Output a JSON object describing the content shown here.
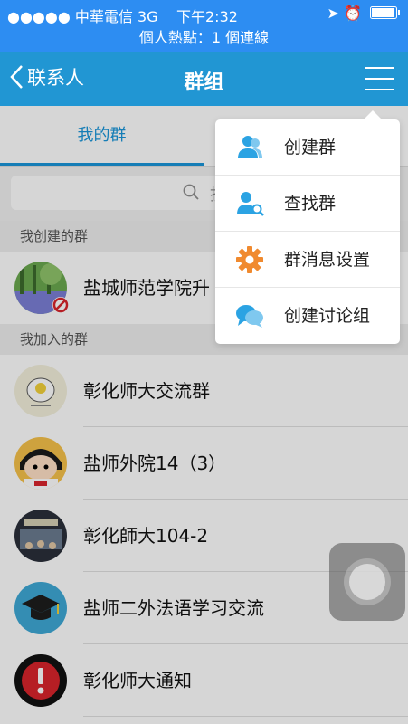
{
  "status_bar": {
    "carrier": "●●●●● 中華電信 3G",
    "time": "下午2:32",
    "right": "➤ ⏰"
  },
  "hotspot_banner": "個人熱點：1 個連線",
  "nav": {
    "back_label": "联系人",
    "title": "群组"
  },
  "tabs": {
    "mine": "我的群",
    "other": ""
  },
  "search": {
    "placeholder": "搜"
  },
  "sections": {
    "created": "我创建的群",
    "joined": "我加入的群"
  },
  "created_groups": [
    {
      "name": "盐城师范学院升"
    }
  ],
  "joined_groups": [
    {
      "name": "彰化师大交流群"
    },
    {
      "name": "盐师外院14（3）"
    },
    {
      "name": "彰化師大104-2"
    },
    {
      "name": "盐师二外法语学习交流"
    },
    {
      "name": "彰化师大通知"
    }
  ],
  "menu": {
    "items": [
      {
        "label": "创建群",
        "icon": "create-group-icon"
      },
      {
        "label": "查找群",
        "icon": "find-group-icon"
      },
      {
        "label": "群消息设置",
        "icon": "gear-icon"
      },
      {
        "label": "创建讨论组",
        "icon": "discussion-icon"
      }
    ]
  },
  "colors": {
    "nav_blue": "#2196d3",
    "status_blue": "#2d8df2",
    "tab_active": "#1a95d9",
    "menu_icon_blue": "#2ba3e3",
    "gear_orange": "#f08a2f"
  }
}
